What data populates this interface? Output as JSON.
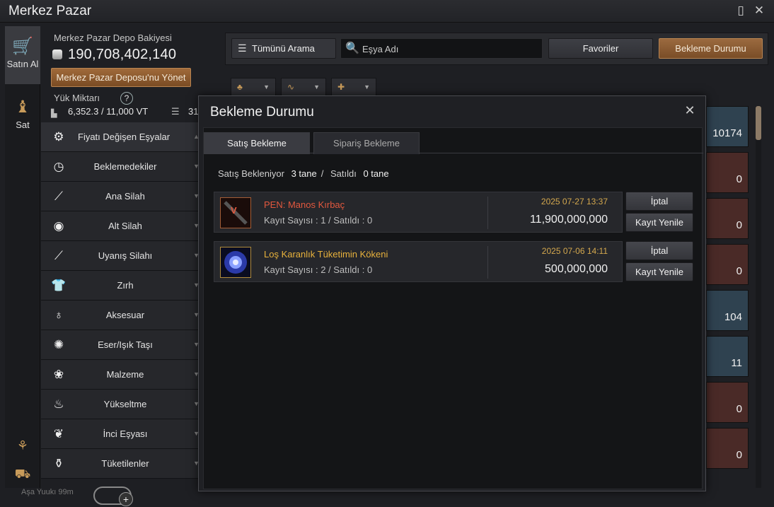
{
  "window": {
    "title": "Merkez Pazar"
  },
  "leftnav": {
    "buy_label": "Satın Al",
    "sell_label": "Sat"
  },
  "balance": {
    "label": "Merkez Pazar Depo Bakiyesi",
    "amount": "190,708,402,140",
    "manage_button": "Merkez Pazar Deposu'nu Yönet",
    "weight_label": "Yük Miktarı",
    "weight_help": "?",
    "weight_value": "6,352.3 / 11,000 VT",
    "slots_value": "31"
  },
  "categories": [
    {
      "label": "Fiyatı Değişen Eşyalar",
      "icon": "gear-icon",
      "glyph": "⚙"
    },
    {
      "label": "Beklemedekiler",
      "icon": "clock-icon",
      "glyph": "◷"
    },
    {
      "label": "Ana Silah",
      "icon": "sword-icon",
      "glyph": "⟋"
    },
    {
      "label": "Alt Silah",
      "icon": "shield-icon",
      "glyph": "◉"
    },
    {
      "label": "Uyanış Silahı",
      "icon": "awakening-icon",
      "glyph": "⟋"
    },
    {
      "label": "Zırh",
      "icon": "armor-icon",
      "glyph": "👕"
    },
    {
      "label": "Aksesuar",
      "icon": "ring-icon",
      "glyph": "♁"
    },
    {
      "label": "Eser/Işık Taşı",
      "icon": "artifact-icon",
      "glyph": "✺"
    },
    {
      "label": "Malzeme",
      "icon": "material-icon",
      "glyph": "❀"
    },
    {
      "label": "Yükseltme",
      "icon": "flame-icon",
      "glyph": "♨"
    },
    {
      "label": "İnci Eşyası",
      "icon": "pearl-icon",
      "glyph": "❦"
    },
    {
      "label": "Tüketilenler",
      "icon": "potion-icon",
      "glyph": "⚱"
    }
  ],
  "topbar": {
    "search_all": "Tümünü Arama",
    "search_placeholder": "Eşya Adı",
    "favorites": "Favoriler",
    "waiting_status": "Bekleme Durumu"
  },
  "right_column": [
    "10174",
    "0",
    "0",
    "0",
    "104",
    "11",
    "0",
    "0"
  ],
  "modal": {
    "title": "Bekleme Durumu",
    "tabs": [
      "Satış Bekleme",
      "Sipariş Bekleme"
    ],
    "summary_label": "Satış Bekleniyor",
    "summary_count": "3 tane",
    "summary_sep": "/",
    "summary_sold_label": "Satıldı",
    "summary_sold": "0 tane",
    "listings": [
      {
        "name": "PEN: Manos Kırbaç",
        "name_color": "#e2583e",
        "meta": "Kayıt Sayısı : 1 / Satıldı : 0",
        "date": "2025 07-27 13:37",
        "price": "11,900,000,000",
        "cancel": "İptal",
        "renew": "Kayıt Yenile"
      },
      {
        "name": "Loş Karanlık Tüketimin Kökeni",
        "name_color": "#e8b23c",
        "meta": "Kayıt Sayısı : 2 / Satıldı : 0",
        "date": "2025 07-06 14:11",
        "price": "500,000,000",
        "cancel": "İptal",
        "renew": "Kayıt Yenile"
      }
    ]
  },
  "bottom": {
    "fragment": "Aşa Yuukı 99m"
  }
}
